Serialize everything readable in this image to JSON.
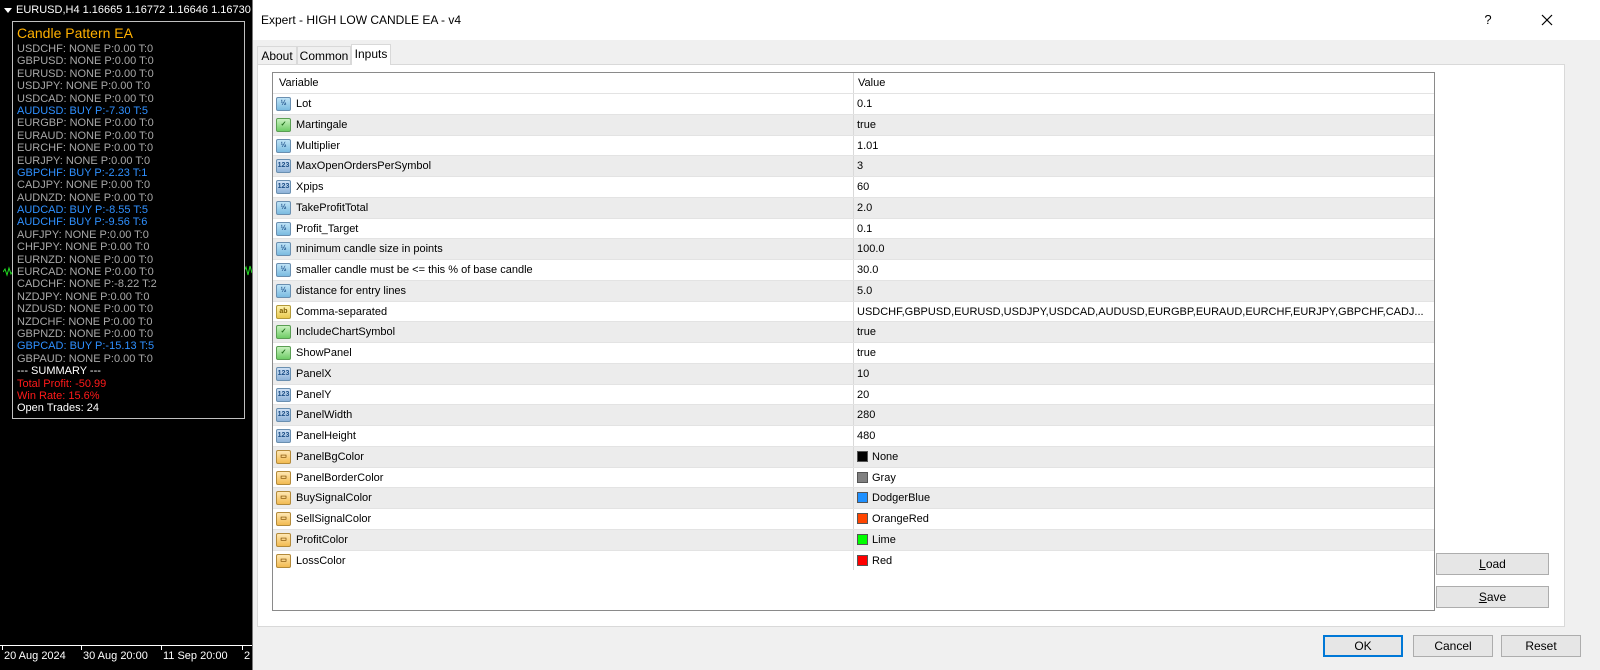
{
  "chart": {
    "header": "EURUSD,H4  1.16665 1.16772 1.16646 1.16730",
    "panel_title": "Candle Pattern EA",
    "rows": [
      {
        "text": "USDCHF: NONE P:0.00 T:0",
        "kind": "none"
      },
      {
        "text": "GBPUSD: NONE P:0.00 T:0",
        "kind": "none"
      },
      {
        "text": "EURUSD: NONE P:0.00 T:0",
        "kind": "none"
      },
      {
        "text": "USDJPY: NONE P:0.00 T:0",
        "kind": "none"
      },
      {
        "text": "USDCAD: NONE P:0.00 T:0",
        "kind": "none"
      },
      {
        "text": "AUDUSD: BUY P:-7.30 T:5",
        "kind": "buy"
      },
      {
        "text": "EURGBP: NONE P:0.00 T:0",
        "kind": "none"
      },
      {
        "text": "EURAUD: NONE P:0.00 T:0",
        "kind": "none"
      },
      {
        "text": "EURCHF: NONE P:0.00 T:0",
        "kind": "none"
      },
      {
        "text": "EURJPY: NONE P:0.00 T:0",
        "kind": "none"
      },
      {
        "text": "GBPCHF: BUY P:-2.23 T:1",
        "kind": "buy"
      },
      {
        "text": "CADJPY: NONE P:0.00 T:0",
        "kind": "none"
      },
      {
        "text": "AUDNZD: NONE P:0.00 T:0",
        "kind": "none"
      },
      {
        "text": "AUDCAD: BUY P:-8.55 T:5",
        "kind": "buy"
      },
      {
        "text": "AUDCHF: BUY P:-9.56 T:6",
        "kind": "buy"
      },
      {
        "text": "AUFJPY: NONE P:0.00 T:0",
        "kind": "none"
      },
      {
        "text": "CHFJPY: NONE P:0.00 T:0",
        "kind": "none"
      },
      {
        "text": "EURNZD: NONE P:0.00 T:0",
        "kind": "none"
      },
      {
        "text": "EURCAD: NONE P:0.00 T:0",
        "kind": "none"
      },
      {
        "text": "CADCHF: NONE P:-8.22 T:2",
        "kind": "none"
      },
      {
        "text": "NZDJPY: NONE P:0.00 T:0",
        "kind": "none"
      },
      {
        "text": "NZDUSD: NONE P:0.00 T:0",
        "kind": "none"
      },
      {
        "text": "NZDCHF: NONE P:0.00 T:0",
        "kind": "none"
      },
      {
        "text": "GBPNZD: NONE P:0.00 T:0",
        "kind": "none"
      },
      {
        "text": "GBPCAD: BUY P:-15.13 T:5",
        "kind": "buy"
      },
      {
        "text": "GBPAUD: NONE P:0.00 T:0",
        "kind": "none"
      }
    ],
    "summary_header": "--- SUMMARY ---",
    "total_profit": "Total Profit: -50.99",
    "win_rate": "Win Rate: 15.6%",
    "open_trades": "Open Trades: 24",
    "dates": [
      "20 Aug 2024",
      "30 Aug 20:00",
      "11 Sep 20:00",
      "2"
    ]
  },
  "dialog": {
    "title": "Expert - HIGH LOW CANDLE EA - v4",
    "help": "?",
    "tabs": [
      "About",
      "Common",
      "Inputs"
    ],
    "active_tab": "Inputs",
    "columns": {
      "variable": "Variable",
      "value": "Value"
    },
    "inputs": [
      {
        "type": "num",
        "icon": "½",
        "name": "Lot",
        "value": "0.1"
      },
      {
        "type": "bool",
        "icon": "✓",
        "name": "Martingale",
        "value": "true"
      },
      {
        "type": "num",
        "icon": "½",
        "name": "Multiplier",
        "value": "1.01"
      },
      {
        "type": "int",
        "icon": "123",
        "name": "MaxOpenOrdersPerSymbol",
        "value": "3"
      },
      {
        "type": "int",
        "icon": "123",
        "name": "Xpips",
        "value": "60"
      },
      {
        "type": "num",
        "icon": "½",
        "name": "TakeProfitTotal",
        "value": "2.0"
      },
      {
        "type": "num",
        "icon": "½",
        "name": "Profit_Target",
        "value": "0.1"
      },
      {
        "type": "num",
        "icon": "½",
        "name": "minimum candle size in points",
        "value": "100.0"
      },
      {
        "type": "num",
        "icon": "½",
        "name": "smaller candle must be <= this % of base candle",
        "value": "30.0"
      },
      {
        "type": "num",
        "icon": "½",
        "name": "distance for entry lines",
        "value": "5.0"
      },
      {
        "type": "str",
        "icon": "ab",
        "name": "Comma-separated",
        "value": "USDCHF,GBPUSD,EURUSD,USDJPY,USDCAD,AUDUSD,EURGBP,EURAUD,EURCHF,EURJPY,GBPCHF,CADJ..."
      },
      {
        "type": "bool",
        "icon": "✓",
        "name": "IncludeChartSymbol",
        "value": "true"
      },
      {
        "type": "bool",
        "icon": "✓",
        "name": "ShowPanel",
        "value": "true"
      },
      {
        "type": "int",
        "icon": "123",
        "name": "PanelX",
        "value": "10"
      },
      {
        "type": "int",
        "icon": "123",
        "name": "PanelY",
        "value": "20"
      },
      {
        "type": "int",
        "icon": "123",
        "name": "PanelWidth",
        "value": "280"
      },
      {
        "type": "int",
        "icon": "123",
        "name": "PanelHeight",
        "value": "480"
      },
      {
        "type": "color",
        "icon": "▭",
        "name": "PanelBgColor",
        "value": "None",
        "swatch": "#000000"
      },
      {
        "type": "color",
        "icon": "▭",
        "name": "PanelBorderColor",
        "value": "Gray",
        "swatch": "#808080"
      },
      {
        "type": "color",
        "icon": "▭",
        "name": "BuySignalColor",
        "value": "DodgerBlue",
        "swatch": "#1e90ff"
      },
      {
        "type": "color",
        "icon": "▭",
        "name": "SellSignalColor",
        "value": "OrangeRed",
        "swatch": "#ff4500"
      },
      {
        "type": "color",
        "icon": "▭",
        "name": "ProfitColor",
        "value": "Lime",
        "swatch": "#00ff00"
      },
      {
        "type": "color",
        "icon": "▭",
        "name": "LossColor",
        "value": "Red",
        "swatch": "#ff0000"
      }
    ],
    "buttons": {
      "load_u": "L",
      "load_rest": "oad",
      "save_u": "S",
      "save_rest": "ave",
      "ok": "OK",
      "cancel": "Cancel",
      "reset": "Reset"
    }
  }
}
